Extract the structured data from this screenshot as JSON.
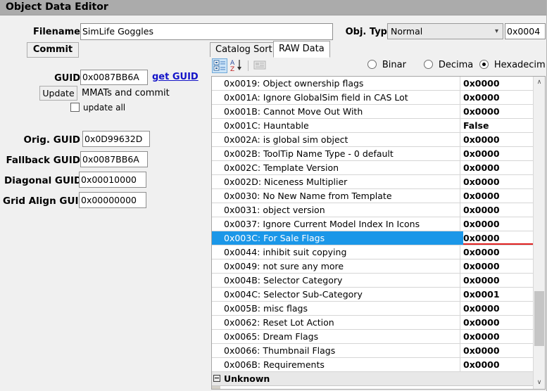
{
  "window": {
    "title": "Object Data Editor"
  },
  "form": {
    "filename_label": "Filename",
    "filename_value": "SimLife Goggles",
    "commit_label": "Commit",
    "objtype_label": "Obj. Typ",
    "objtype_value": "Normal",
    "objtype_code": "0x0004",
    "guid_label": "GUID",
    "guid_value": "0x0087BB6A",
    "get_guid_link": "get GUID",
    "update_label": "Update",
    "update_note": "MMATs and commit",
    "update_all_label": "update all",
    "update_all_checked": false,
    "orig_guid_label": "Orig. GUID",
    "orig_guid_value": "0x0D99632D",
    "fallback_guid_label": "Fallback GUID",
    "fallback_guid_value": "0x0087BB6A",
    "diagonal_guid_label": "Diagonal GUID",
    "diagonal_guid_value": "0x00010000",
    "gridalign_guid_label": "Grid Align GUID",
    "gridalign_guid_value": "0x00000000"
  },
  "tabs": [
    {
      "label": "Catalog Sort",
      "active": false
    },
    {
      "label": "RAW Data",
      "active": true
    }
  ],
  "toolbar": {
    "categorized_icon": "categorized-view-icon",
    "sort_icon": "alphabetical-sort-icon",
    "pages_icon": "property-pages-icon",
    "radios": [
      {
        "label": "Binar",
        "selected": false
      },
      {
        "label": "Decima",
        "selected": false
      },
      {
        "label": "Hexadecim",
        "selected": true
      }
    ]
  },
  "grid": {
    "rows": [
      {
        "name": "0x0019: Object ownership flags",
        "value": "0x0000",
        "selected": false,
        "category": false
      },
      {
        "name": "0x001A: Ignore GlobalSim field in CAS Lot",
        "value": "0x0000",
        "selected": false,
        "category": false
      },
      {
        "name": "0x001B: Cannot Move Out With",
        "value": "0x0000",
        "selected": false,
        "category": false
      },
      {
        "name": "0x001C: Hauntable",
        "value": "False",
        "selected": false,
        "category": false
      },
      {
        "name": "0x002A: is global sim object",
        "value": "0x0000",
        "selected": false,
        "category": false
      },
      {
        "name": "0x002B: ToolTip Name Type - 0 default",
        "value": "0x0000",
        "selected": false,
        "category": false
      },
      {
        "name": "0x002C: Template Version",
        "value": "0x0000",
        "selected": false,
        "category": false
      },
      {
        "name": "0x002D: Niceness Multiplier",
        "value": "0x0000",
        "selected": false,
        "category": false
      },
      {
        "name": "0x0030: No New Name from Template",
        "value": "0x0000",
        "selected": false,
        "category": false
      },
      {
        "name": "0x0031: object version",
        "value": "0x0000",
        "selected": false,
        "category": false
      },
      {
        "name": "0x0037: Ignore Current Model Index In Icons",
        "value": "0x0000",
        "selected": false,
        "category": false
      },
      {
        "name": "0x003C: For Sale Flags",
        "value": "0x0000",
        "selected": true,
        "category": false
      },
      {
        "name": "0x0044: inhibit suit copying",
        "value": "0x0000",
        "selected": false,
        "category": false
      },
      {
        "name": "0x0049: not sure any more",
        "value": "0x0000",
        "selected": false,
        "category": false
      },
      {
        "name": "0x004B: Selector Category",
        "value": "0x0000",
        "selected": false,
        "category": false
      },
      {
        "name": "0x004C: Selector Sub-Category",
        "value": "0x0001",
        "selected": false,
        "category": false
      },
      {
        "name": "0x005B: misc flags",
        "value": "0x0000",
        "selected": false,
        "category": false
      },
      {
        "name": "0x0062: Reset Lot Action",
        "value": "0x0000",
        "selected": false,
        "category": false
      },
      {
        "name": "0x0065: Dream Flags",
        "value": "0x0000",
        "selected": false,
        "category": false
      },
      {
        "name": "0x0066: Thumbnail Flags",
        "value": "0x0000",
        "selected": false,
        "category": false
      },
      {
        "name": "0x006B: Requirements",
        "value": "0x0000",
        "selected": false,
        "category": false
      },
      {
        "name": "Unknown",
        "value": "",
        "selected": false,
        "category": true
      }
    ]
  },
  "scrollbar": {
    "up_arrow": "∧",
    "down_arrow": "∨"
  },
  "colors": {
    "titlebar": "#ababab",
    "selection": "#1b97e8",
    "error_underline": "#e02020",
    "link": "#1414c8"
  }
}
